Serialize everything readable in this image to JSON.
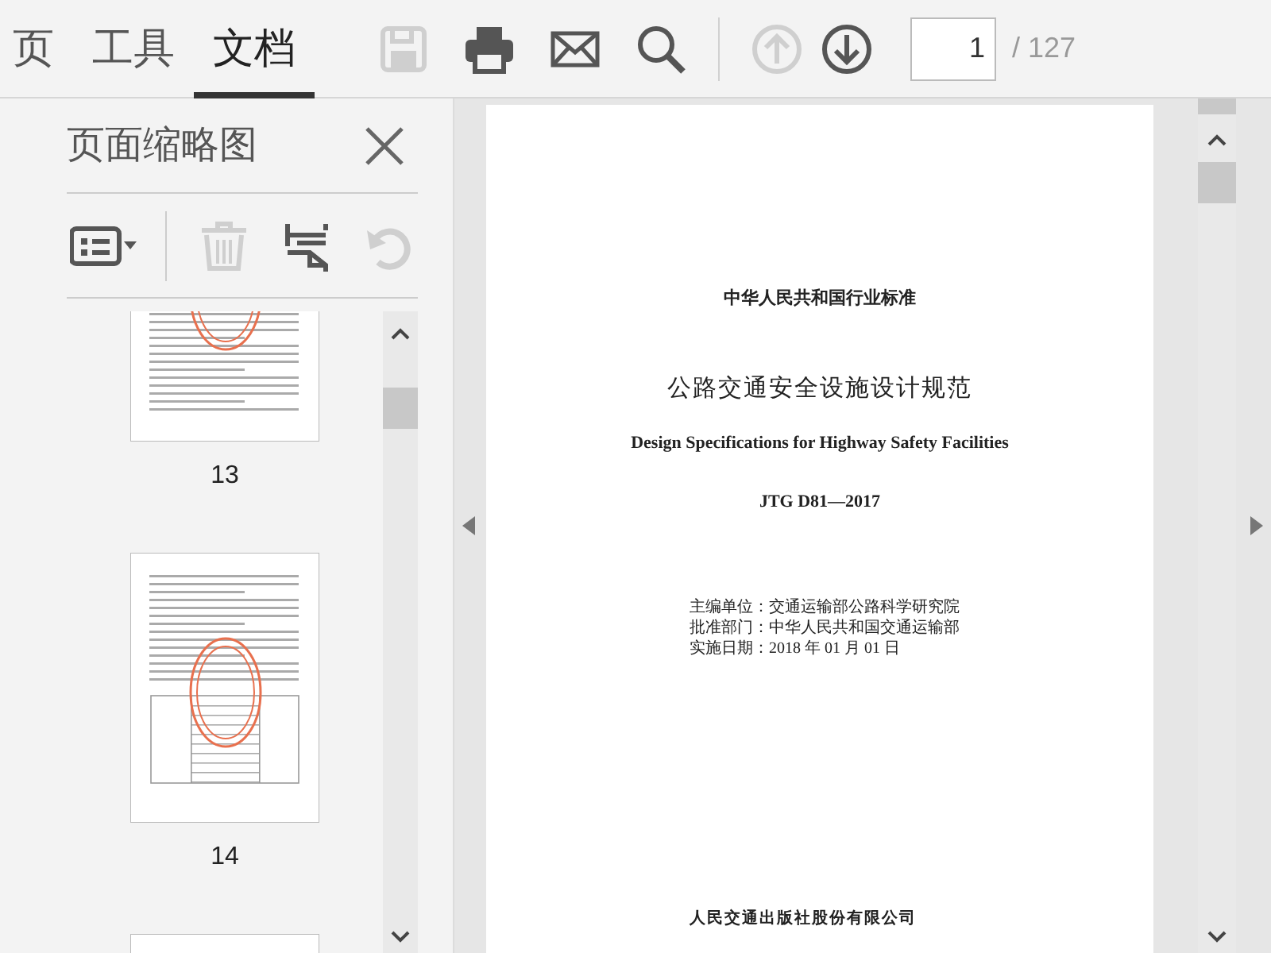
{
  "tabs": [
    {
      "label": "页",
      "selected": false
    },
    {
      "label": "工具",
      "selected": false
    },
    {
      "label": "文档",
      "selected": true
    }
  ],
  "toolbar_icons": [
    {
      "kind": "save",
      "disabled": true
    },
    {
      "kind": "print",
      "disabled": false
    },
    {
      "kind": "mail",
      "disabled": false
    },
    {
      "kind": "search",
      "disabled": false
    }
  ],
  "navigation": [
    {
      "kind": "up",
      "disabled": true
    },
    {
      "kind": "down",
      "disabled": false
    }
  ],
  "page_input": {
    "value": "1"
  },
  "page_count": "/ 127",
  "sidebar": {
    "title": "页面缩略图",
    "tools": [
      {
        "kind": "options",
        "disabled": false
      },
      {
        "kind": "delete",
        "disabled": true
      },
      {
        "kind": "extract",
        "disabled": false
      },
      {
        "kind": "rotate",
        "disabled": true
      }
    ],
    "thumbnails": [
      {
        "label": "13",
        "table": false
      },
      {
        "label": "14",
        "table": true
      }
    ]
  },
  "document": {
    "standard": "中华人民共和国行业标准",
    "title": "公路交通安全设施设计规范",
    "english_title": "Design Specifications for Highway Safety Facilities",
    "code": "JTG D81—2017",
    "details": [
      "主编单位：交通运输部公路科学研究院",
      "批准部门：中华人民共和国交通运输部",
      "实施日期：2018 年 01 月 01 日"
    ],
    "publisher": "人民交通出版社股份有限公司"
  }
}
